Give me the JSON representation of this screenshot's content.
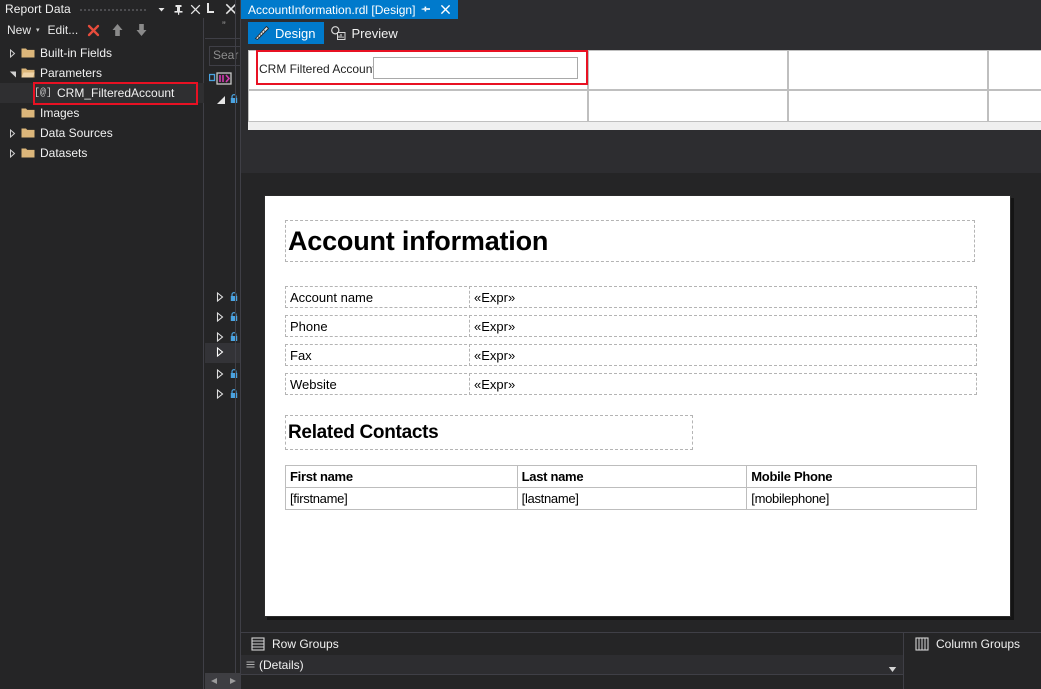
{
  "colors": {
    "accent": "#007acc",
    "highlight_red": "#e81123",
    "panel_bg": "#252526",
    "tab_bg": "#2d2d30",
    "folder_gold": "#dcb67a",
    "close_red": "#e74c3c"
  },
  "report_data_panel": {
    "title": "Report Data",
    "header_icons": [
      {
        "name": "chevron-down-icon",
        "glyph": "▾"
      },
      {
        "name": "pin-icon",
        "glyph": "📌"
      },
      {
        "name": "close-icon",
        "glyph": "✕"
      }
    ],
    "toolbar": {
      "new_label": "New",
      "new_caret": "▾",
      "edit_label": "Edit...",
      "delete_icon": "delete-x-icon",
      "move_up_icon": "move-up-arrow-icon",
      "move_down_icon": "move-down-arrow-icon"
    },
    "tree": [
      {
        "label": "Built-in Fields",
        "icon": "folder-icon",
        "expander": "collapsed",
        "indent": 0,
        "selected": false
      },
      {
        "label": "Parameters",
        "icon": "folder-open-icon",
        "expander": "expanded",
        "indent": 0,
        "selected": false
      },
      {
        "label": "CRM_FilteredAccount",
        "icon": "parameter-icon",
        "expander": "none",
        "indent": 1,
        "selected": true
      },
      {
        "label": "Images",
        "icon": "folder-icon",
        "expander": "none",
        "indent": 0,
        "selected": false
      },
      {
        "label": "Data Sources",
        "icon": "folder-icon",
        "expander": "collapsed",
        "indent": 0,
        "selected": false
      },
      {
        "label": "Datasets",
        "icon": "folder-icon",
        "expander": "collapsed",
        "indent": 0,
        "selected": false
      }
    ]
  },
  "toolbox_strip": {
    "search_placeholder": "Sear",
    "close_icon": "close-icon",
    "pin_icon": "pin-icon",
    "quote_glyph": "”"
  },
  "document_tab": {
    "title": "AccountInformation.rdl [Design]",
    "pin_icon": "pin-icon",
    "close_icon": "close-icon"
  },
  "mode_bar": {
    "tabs": [
      {
        "label": "Design",
        "icon": "design-ruler-icon",
        "active": true
      },
      {
        "label": "Preview",
        "icon": "preview-magnifier-icon",
        "active": false
      }
    ]
  },
  "parameter_pane": {
    "parameter_label": "CRM Filtered Account",
    "parameter_value": ""
  },
  "report_design": {
    "title": "Account information",
    "fields": [
      {
        "label": "Account name",
        "value": "«Expr»"
      },
      {
        "label": "Phone",
        "value": "«Expr»"
      },
      {
        "label": "Fax",
        "value": "«Expr»"
      },
      {
        "label": "Website",
        "value": "«Expr»"
      }
    ],
    "subtitle": "Related Contacts",
    "contacts_table": {
      "headers": [
        "First name",
        "Last name",
        "Mobile Phone"
      ],
      "rows": [
        [
          "[firstname]",
          "[lastname]",
          "[mobilephone]"
        ]
      ]
    }
  },
  "groups_pane": {
    "row_groups_label": "Row Groups",
    "row_groups_icon": "row-groups-icon",
    "column_groups_label": "Column Groups",
    "column_groups_icon": "column-groups-icon",
    "details_label": "(Details)",
    "details_caret": "▾"
  }
}
